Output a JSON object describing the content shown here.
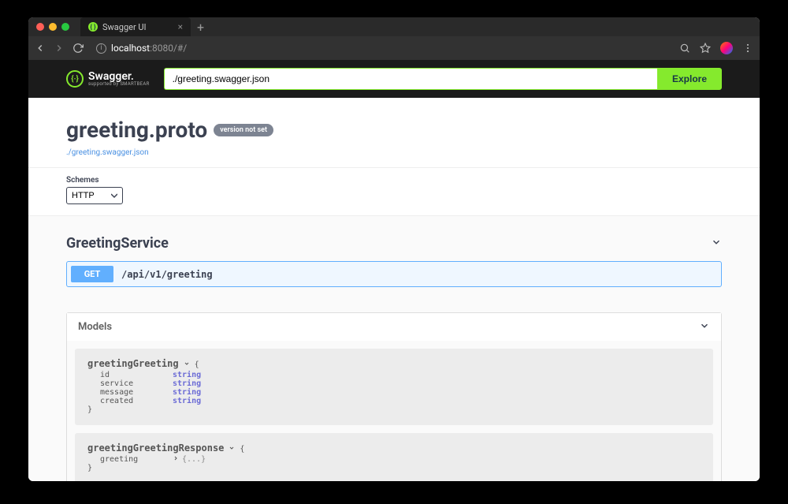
{
  "browser": {
    "tab_title": "Swagger UI",
    "url_host": "localhost",
    "url_port_path": ":8080/#/"
  },
  "topbar": {
    "logo_text": "Swagger.",
    "logo_sub": "supported by SMARTBEAR",
    "explore_input_value": "./greeting.swagger.json",
    "explore_button": "Explore"
  },
  "info": {
    "title": "greeting.proto",
    "version_badge": "version not set",
    "spec_link": "./greeting.swagger.json"
  },
  "schemes": {
    "label": "Schemes",
    "selected": "HTTP"
  },
  "tags": [
    {
      "name": "GreetingService",
      "operations": [
        {
          "method": "GET",
          "path": "/api/v1/greeting"
        }
      ]
    }
  ],
  "models": {
    "title": "Models",
    "items": [
      {
        "name": "greetingGreeting",
        "properties": [
          {
            "name": "id",
            "type": "string"
          },
          {
            "name": "service",
            "type": "string"
          },
          {
            "name": "message",
            "type": "string"
          },
          {
            "name": "created",
            "type": "string"
          }
        ]
      },
      {
        "name": "greetingGreetingResponse",
        "nested": [
          {
            "name": "greeting",
            "placeholder": "{...}"
          }
        ]
      }
    ]
  }
}
